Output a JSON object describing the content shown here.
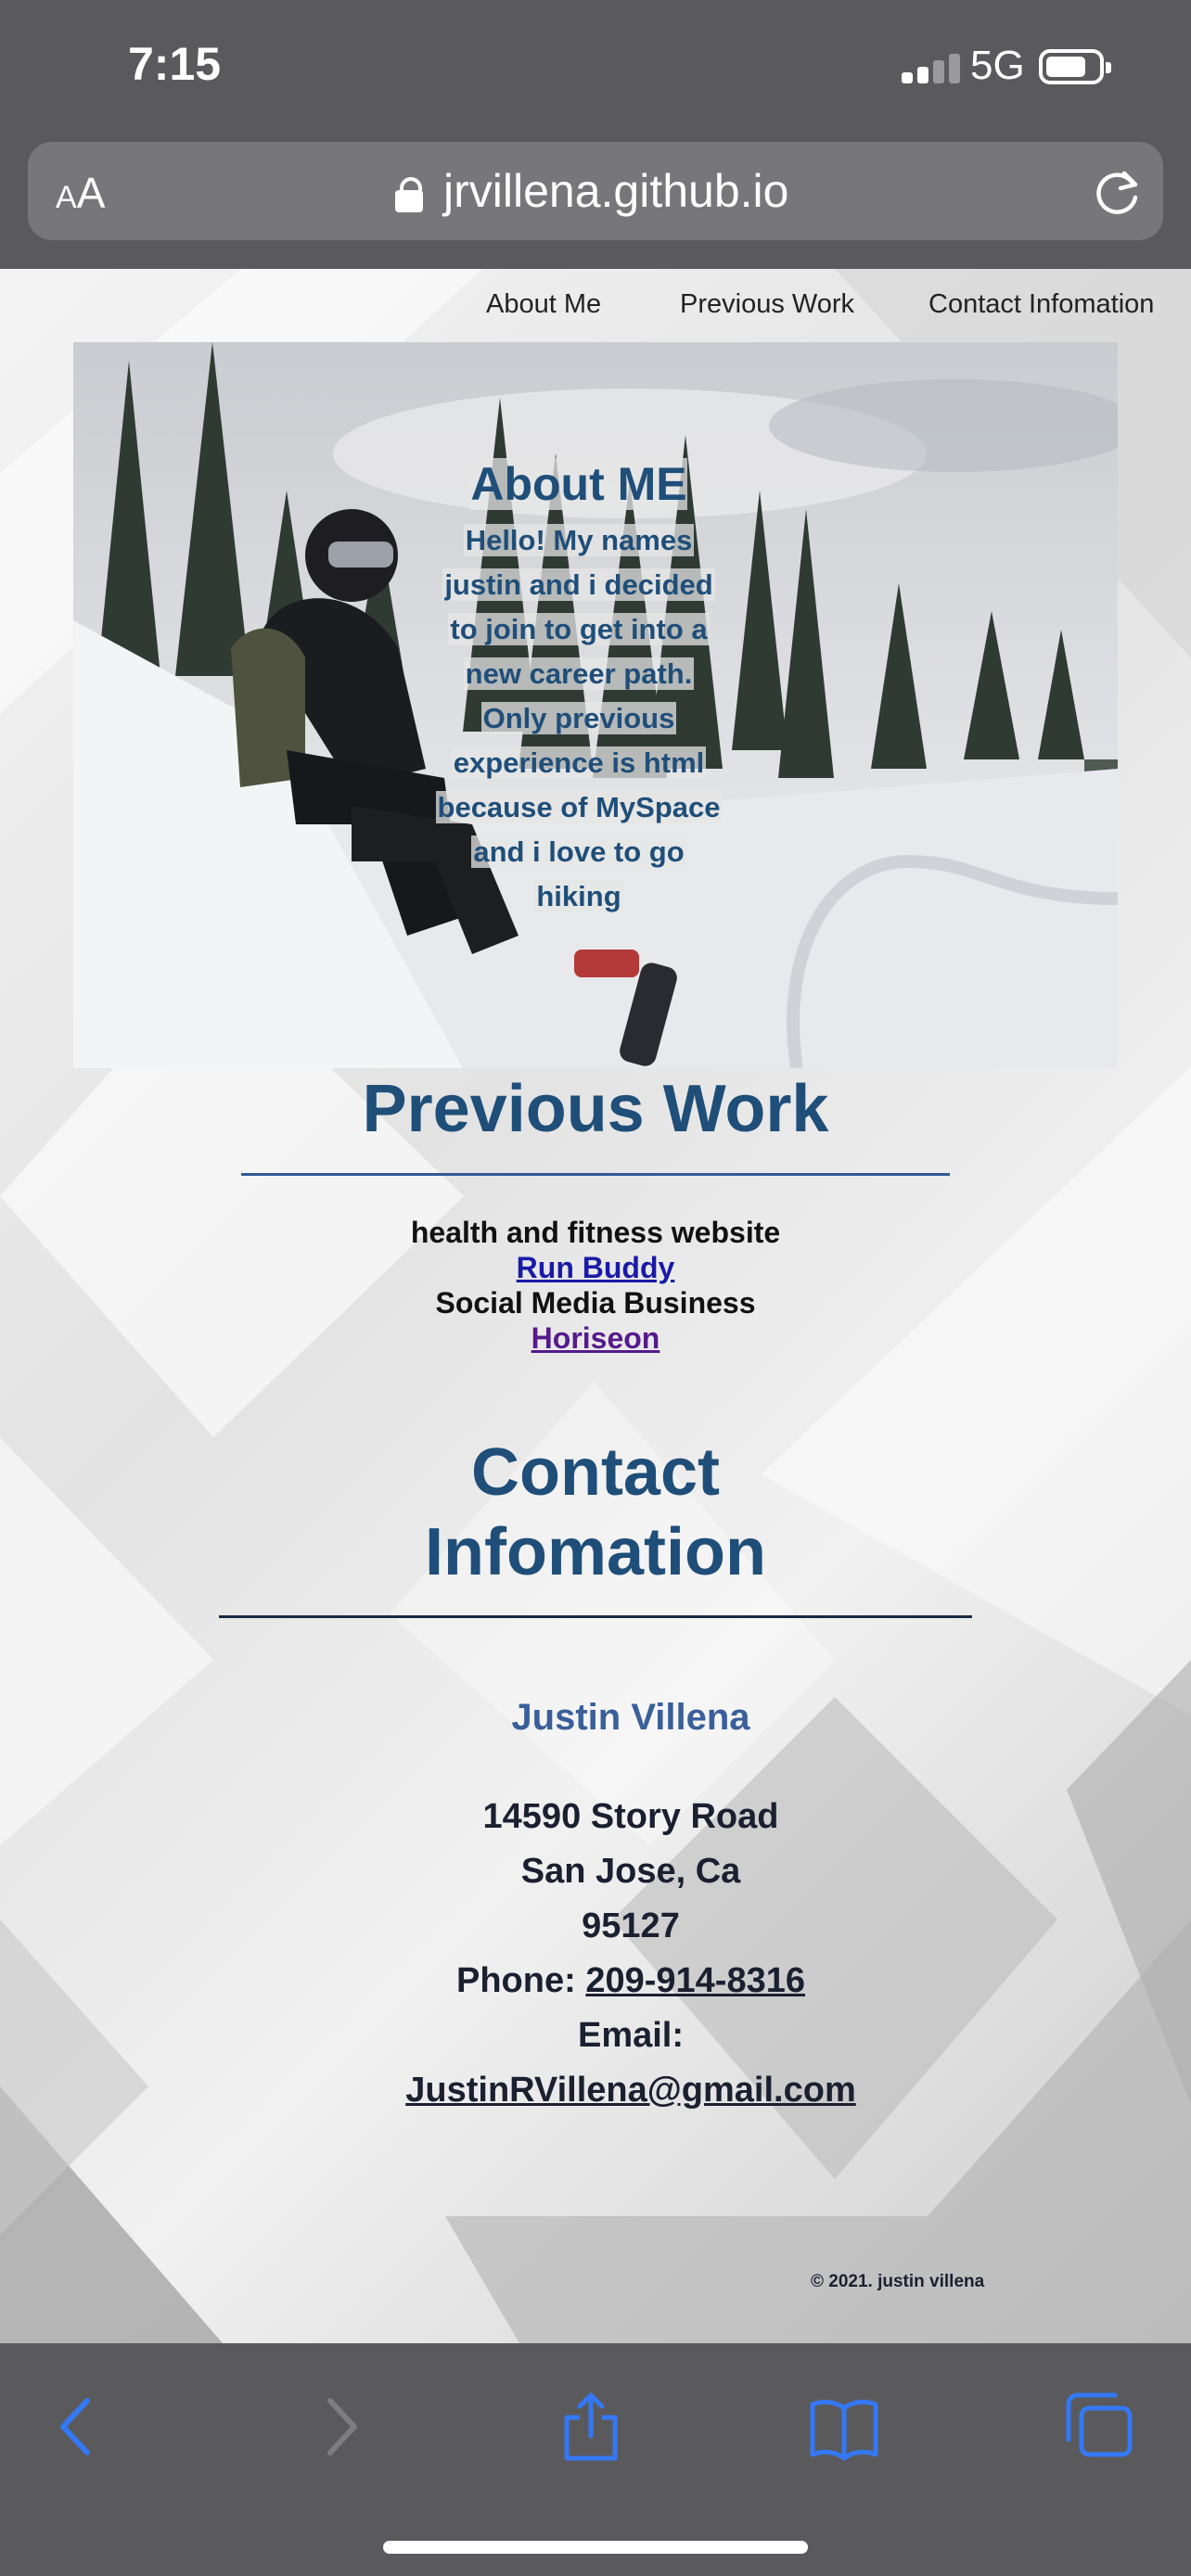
{
  "status_bar": {
    "time": "7:15",
    "network": "5G"
  },
  "browser": {
    "aa_label_small": "A",
    "aa_label_large": "A",
    "url": "jrvillena.github.io"
  },
  "nav": {
    "items": [
      "About Me",
      "Previous Work",
      "Contact Infomation"
    ]
  },
  "about": {
    "title": "About ME",
    "lines": [
      "Hello! My names",
      "justin and i decided",
      "to join to get into a",
      "new career path.",
      "Only previous",
      "experience is html",
      "because of MySpace",
      "and i love to go",
      "hiking"
    ]
  },
  "previous_work": {
    "title": "Previous Work",
    "items": [
      {
        "description": "health and fitness website",
        "link": "Run Buddy"
      },
      {
        "description": "Social Media Business",
        "link": "Horiseon"
      }
    ]
  },
  "contact": {
    "title_line1": "Contact",
    "title_line2": "Infomation",
    "name": "Justin Villena",
    "address1": "14590 Story Road",
    "address2": "San Jose, Ca",
    "zip": "95127",
    "phone_label": "Phone: ",
    "phone": "209-914-8316",
    "email_label": "Email:",
    "email": "JustinRVillena@gmail.com"
  },
  "footer": {
    "copyright": "© 2021. justin villena"
  },
  "colors": {
    "heading": "#1f4e79",
    "accent_blue": "#3478f6",
    "browser_chrome": "#5a5a5c"
  },
  "icons": {
    "back": "chevron-left-icon",
    "forward": "chevron-right-icon",
    "share": "share-icon",
    "bookmarks": "book-icon",
    "tabs": "tabs-icon",
    "reload": "reload-icon",
    "lock": "lock-icon"
  }
}
